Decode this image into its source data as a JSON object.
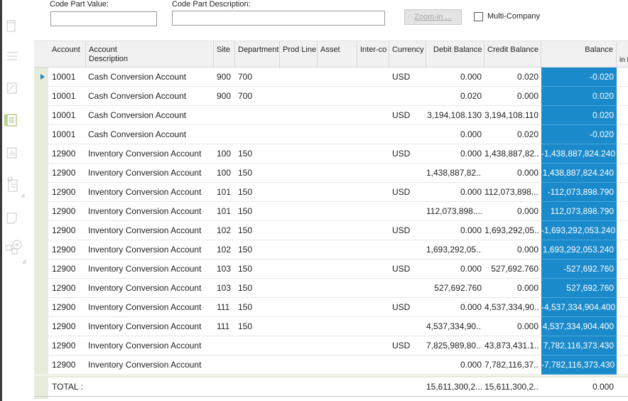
{
  "filters": {
    "code_part_value_label": "Code Part Value:",
    "code_part_description_label": "Code Part Description:",
    "zoom_in_label": "Zoom-in ...",
    "multi_company_label": "Multi-Company"
  },
  "columns": [
    "Account",
    "Account Description",
    "Site",
    "Department",
    "Prod Line",
    "Asset",
    "Inter-co",
    "Currency",
    "Debit Balance",
    "Credit Balance",
    "Balance",
    "in F"
  ],
  "column_header_lines": {
    "account_description_line1": "Account",
    "account_description_line2": "Description"
  },
  "rows": [
    {
      "account": "10001",
      "description": "Cash Conversion Account",
      "site": "900",
      "department": "700",
      "currency": "USD",
      "debit": "0.000",
      "credit": "0.020",
      "balance": "-0.020"
    },
    {
      "account": "10001",
      "description": "Cash Conversion Account",
      "site": "900",
      "department": "700",
      "currency": "",
      "debit": "0.020",
      "credit": "0.000",
      "balance": "0.020"
    },
    {
      "account": "10001",
      "description": "Cash Conversion Account",
      "site": "",
      "department": "",
      "currency": "USD",
      "debit": "3,194,108.130",
      "credit": "3,194,108.110",
      "balance": "0.020"
    },
    {
      "account": "10001",
      "description": "Cash Conversion Account",
      "site": "",
      "department": "",
      "currency": "",
      "debit": "0.000",
      "credit": "0.020",
      "balance": "-0.020"
    },
    {
      "account": "12900",
      "description": "Inventory Conversion Account",
      "site": "100",
      "department": "150",
      "currency": "USD",
      "debit": "0.000",
      "credit": "1,438,887,82...",
      "balance": "-1,438,887,824.240"
    },
    {
      "account": "12900",
      "description": "Inventory Conversion Account",
      "site": "100",
      "department": "150",
      "currency": "",
      "debit": "1,438,887,82...",
      "credit": "0.000",
      "balance": "1,438,887,824.240"
    },
    {
      "account": "12900",
      "description": "Inventory Conversion Account",
      "site": "101",
      "department": "150",
      "currency": "USD",
      "debit": "0.000",
      "credit": "112,073,898....",
      "balance": "-112,073,898.790"
    },
    {
      "account": "12900",
      "description": "Inventory Conversion Account",
      "site": "101",
      "department": "150",
      "currency": "",
      "debit": "112,073,898....",
      "credit": "0.000",
      "balance": "112,073,898.790"
    },
    {
      "account": "12900",
      "description": "Inventory Conversion Account",
      "site": "102",
      "department": "150",
      "currency": "USD",
      "debit": "0.000",
      "credit": "1,693,292,05...",
      "balance": "-1,693,292,053.240"
    },
    {
      "account": "12900",
      "description": "Inventory Conversion Account",
      "site": "102",
      "department": "150",
      "currency": "",
      "debit": "1,693,292,05...",
      "credit": "0.000",
      "balance": "1,693,292,053.240"
    },
    {
      "account": "12900",
      "description": "Inventory Conversion Account",
      "site": "103",
      "department": "150",
      "currency": "USD",
      "debit": "0.000",
      "credit": "527,692.760",
      "balance": "-527,692.760"
    },
    {
      "account": "12900",
      "description": "Inventory Conversion Account",
      "site": "103",
      "department": "150",
      "currency": "",
      "debit": "527,692.760",
      "credit": "0.000",
      "balance": "527,692.760"
    },
    {
      "account": "12900",
      "description": "Inventory Conversion Account",
      "site": "111",
      "department": "150",
      "currency": "USD",
      "debit": "0.000",
      "credit": "4,537,334,90...",
      "balance": "-4,537,334,904.400"
    },
    {
      "account": "12900",
      "description": "Inventory Conversion Account",
      "site": "111",
      "department": "150",
      "currency": "",
      "debit": "4,537,334,90...",
      "credit": "0.000",
      "balance": "4,537,334,904.400"
    },
    {
      "account": "12900",
      "description": "Inventory Conversion Account",
      "site": "",
      "department": "",
      "currency": "USD",
      "debit": "7,825,989,80...",
      "credit": "43,873,431.1...",
      "balance": "7,782,116,373.430"
    },
    {
      "account": "12900",
      "description": "Inventory Conversion Account",
      "site": "",
      "department": "",
      "currency": "",
      "debit": "0.000",
      "credit": "7,782,116,37...",
      "balance": "-7,782,116,373.430"
    }
  ],
  "total": {
    "label": "TOTAL :",
    "debit": "15,611,300,2...",
    "credit": "15,611,300,2...",
    "balance": "0.000"
  },
  "selected_row_index": 0,
  "colors": {
    "balance_highlight": "#1b8acb",
    "row_selector": "#e5ecd9",
    "row_arrow": "#1a88c9"
  },
  "side_icons": [
    "document-icon",
    "list-icon",
    "chart-trend-icon",
    "document-list-icon",
    "bar-chart-icon",
    "document-settings-icon",
    "note-icon",
    "add-node-icon"
  ]
}
